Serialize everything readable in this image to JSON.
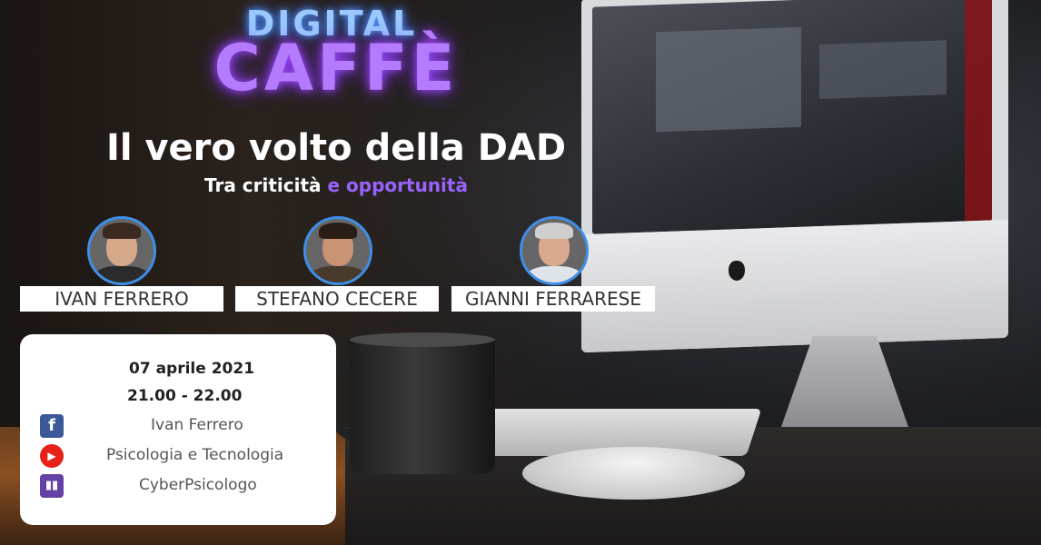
{
  "header": {
    "brand_top": "DIGITAL",
    "brand_bottom": "CAFFÈ",
    "title": "Il vero volto della DAD",
    "subtitle_part1": "Tra criticità",
    "subtitle_part2": "e opportunità"
  },
  "speakers": [
    {
      "name": "IVAN FERRERO"
    },
    {
      "name": "STEFANO CECERE"
    },
    {
      "name": "GIANNI FERRARESE"
    }
  ],
  "event": {
    "date": "07 aprile 2021",
    "time": "21.00 - 22.00"
  },
  "socials": [
    {
      "icon": "facebook-icon",
      "label": "Ivan Ferrero"
    },
    {
      "icon": "youtube-icon",
      "label": "Psicologia e Tecnologia"
    },
    {
      "icon": "twitch-icon",
      "label": "CyberPsicologo"
    }
  ],
  "colors": {
    "neon_blue": "#9ac8ff",
    "neon_purple": "#b57bff",
    "accent_purple": "#9a63ff",
    "avatar_border": "#3f8ee8",
    "facebook": "#3b5998",
    "youtube": "#e62117",
    "twitch": "#6441a5"
  }
}
